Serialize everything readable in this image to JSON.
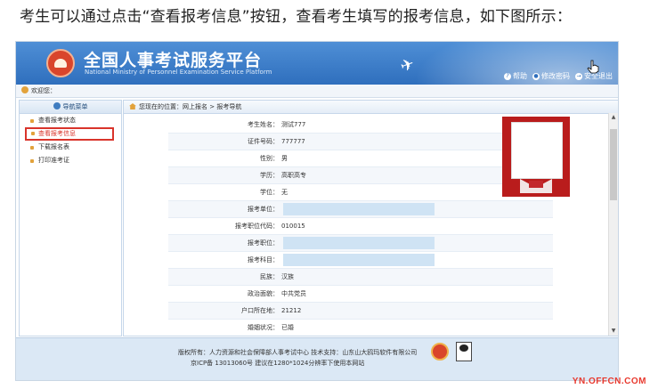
{
  "caption": "考生可以通过点击“查看报考信息”按钮，查看考生填写的报考信息，如下图所示：",
  "header": {
    "title": "全国人事考试服务平台",
    "subtitle": "National Ministry of Personnel Examination Service Platform",
    "links": [
      {
        "label": "帮助",
        "icon": "help-icon"
      },
      {
        "label": "修改密码",
        "icon": "key-icon"
      },
      {
        "label": "安全退出",
        "icon": "exit-icon"
      }
    ]
  },
  "welcome": "欢迎您：",
  "sidebar": {
    "title": "导航菜单",
    "items": [
      {
        "label": "查看报考状态"
      },
      {
        "label": "查看报考信息"
      },
      {
        "label": "下载报名表"
      },
      {
        "label": "打印准考证"
      }
    ]
  },
  "breadcrumb": "您现在的位置：网上报名 > 报考导航",
  "fields": [
    {
      "label": "考生姓名：",
      "value": "测试777"
    },
    {
      "label": "证件号码：",
      "value": "777777"
    },
    {
      "label": "性别：",
      "value": "男"
    },
    {
      "label": "学历：",
      "value": "高职高专"
    },
    {
      "label": "学位：",
      "value": "无"
    },
    {
      "label": "报考单位：",
      "value": ""
    },
    {
      "label": "报考职位代码：",
      "value": "010015"
    },
    {
      "label": "报考职位：",
      "value": ""
    },
    {
      "label": "报考科目：",
      "value": ""
    },
    {
      "label": "民族：",
      "value": "汉族"
    },
    {
      "label": "政治面貌：",
      "value": "中共党员"
    },
    {
      "label": "户口所在地：",
      "value": "21212"
    },
    {
      "label": "婚姻状况：",
      "value": "已婚"
    }
  ],
  "footer": {
    "line1": "版权所有：人力资源和社会保障部人事考试中心  技术支持：山东山大鸥玛软件有限公司",
    "line2": "京ICP备 13013060号  建议在1280*1024分辨率下使用本网站"
  },
  "watermark": "YN.OFFCN.COM",
  "colors": {
    "banner": "#2f6fbd",
    "active": "#d9342b",
    "accent": "#e2a23b",
    "highlight": "#cfe3f4"
  }
}
